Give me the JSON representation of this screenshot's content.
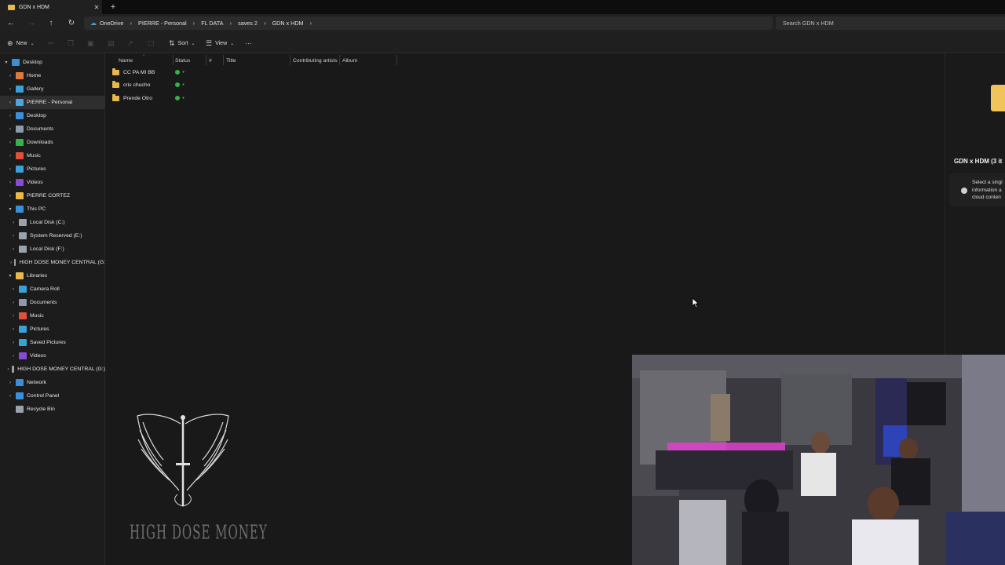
{
  "window": {
    "tab_title": "GDN x HDM",
    "close_glyph": "✕",
    "newtab_glyph": "+"
  },
  "address_bar": {
    "crumbs": [
      "OneDrive",
      "PIERRE - Personal",
      "FL DATA",
      "saves 2",
      "GDN x HDM"
    ],
    "separator": "›"
  },
  "search": {
    "placeholder": "Search GDN x HDM"
  },
  "toolbar": {
    "new_label": "New",
    "sort_label": "Sort",
    "view_label": "View",
    "more_glyph": "···"
  },
  "sidebar": {
    "items": [
      {
        "label": "Desktop",
        "level": 0,
        "expanded": true,
        "icon": "desktop-icon",
        "color": "#3a8fd8"
      },
      {
        "label": "Home",
        "level": 1,
        "icon": "home-icon",
        "color": "#e07a3a"
      },
      {
        "label": "Gallery",
        "level": 1,
        "icon": "gallery-icon",
        "color": "#3aa0d8"
      },
      {
        "label": "PIERRE - Personal",
        "level": 1,
        "icon": "onedrive-icon",
        "color": "#4fa3e0",
        "selected": true
      },
      {
        "label": "Desktop",
        "level": 1,
        "icon": "desktop-icon",
        "color": "#3a8fd8"
      },
      {
        "label": "Documents",
        "level": 1,
        "icon": "documents-icon",
        "color": "#8a9bb0"
      },
      {
        "label": "Downloads",
        "level": 1,
        "icon": "downloads-icon",
        "color": "#36b24a"
      },
      {
        "label": "Music",
        "level": 1,
        "icon": "music-icon",
        "color": "#e0503a"
      },
      {
        "label": "Pictures",
        "level": 1,
        "icon": "pictures-icon",
        "color": "#3aa0d8"
      },
      {
        "label": "Videos",
        "level": 1,
        "icon": "videos-icon",
        "color": "#8a4ad8"
      },
      {
        "label": "PIERRE CORTEZ",
        "level": 1,
        "icon": "folder-icon",
        "color": "#e8b84a"
      },
      {
        "label": "This PC",
        "level": 1,
        "expanded": true,
        "icon": "pc-icon",
        "color": "#3a8fd8"
      },
      {
        "label": "Local Disk (C:)",
        "level": 2,
        "icon": "disk-icon",
        "color": "#9aa3ad"
      },
      {
        "label": "System Reserved (E:)",
        "level": 2,
        "icon": "disk-icon",
        "color": "#9aa3ad"
      },
      {
        "label": "Local Disk (F:)",
        "level": 2,
        "icon": "disk-icon",
        "color": "#9aa3ad"
      },
      {
        "label": "HIGH DOSE MONEY CENTRAL (G:",
        "level": 2,
        "icon": "disk-icon",
        "color": "#9aa3ad"
      },
      {
        "label": "Libraries",
        "level": 1,
        "expanded": true,
        "icon": "libraries-icon",
        "color": "#e8b84a"
      },
      {
        "label": "Camera Roll",
        "level": 2,
        "icon": "camera-roll-icon",
        "color": "#3aa0d8"
      },
      {
        "label": "Documents",
        "level": 2,
        "icon": "documents-icon",
        "color": "#8a9bb0"
      },
      {
        "label": "Music",
        "level": 2,
        "icon": "music-icon",
        "color": "#e0503a"
      },
      {
        "label": "Pictures",
        "level": 2,
        "icon": "pictures-icon",
        "color": "#3aa0d8"
      },
      {
        "label": "Saved Pictures",
        "level": 2,
        "icon": "pictures-icon",
        "color": "#3aa0d8"
      },
      {
        "label": "Videos",
        "level": 2,
        "icon": "videos-icon",
        "color": "#8a4ad8"
      },
      {
        "label": "HIGH DOSE MONEY CENTRAL (G:)",
        "level": 1,
        "icon": "disk-icon",
        "color": "#9aa3ad"
      },
      {
        "label": "Network",
        "level": 1,
        "icon": "network-icon",
        "color": "#3a8fd8"
      },
      {
        "label": "Control Panel",
        "level": 1,
        "icon": "control-panel-icon",
        "color": "#3a8fd8"
      },
      {
        "label": "Recycle Bin",
        "level": 1,
        "icon": "recycle-bin-icon",
        "color": "#9aa3ad",
        "no_chevron": true
      }
    ]
  },
  "columns": [
    "Name",
    "Status",
    "#",
    "Title",
    "Contributing artists",
    "Album"
  ],
  "files": [
    {
      "name": "CC PA MI BB",
      "status": "synced"
    },
    {
      "name": "cris chucho",
      "status": "synced"
    },
    {
      "name": "Prende Otro",
      "status": "synced"
    }
  ],
  "details_pane": {
    "title": "GDN x HDM (3 it",
    "info_lines": [
      "Select a singl",
      "information a",
      "cloud conten"
    ]
  },
  "overlay": {
    "logo_text": "HIGH DOSE MONEY"
  }
}
